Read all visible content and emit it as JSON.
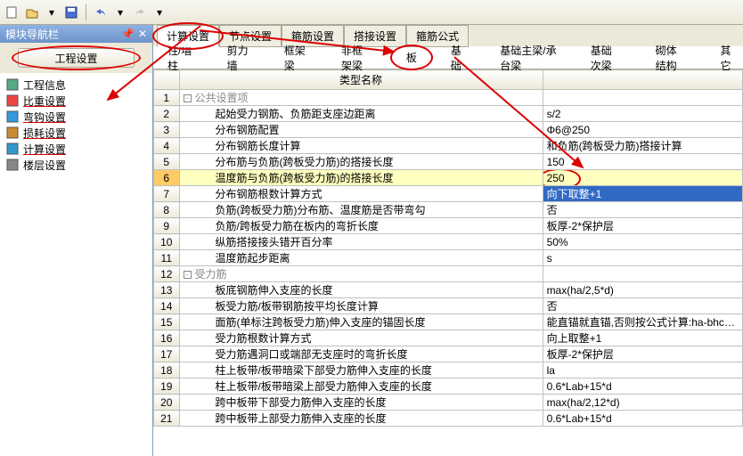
{
  "nav": {
    "title": "模块导航栏",
    "button": "工程设置",
    "items": [
      {
        "icon": "page-icon",
        "label": "工程信息"
      },
      {
        "icon": "weight-icon",
        "label": "比重设置"
      },
      {
        "icon": "hook-icon",
        "label": "弯钩设置"
      },
      {
        "icon": "loss-icon",
        "label": "损耗设置"
      },
      {
        "icon": "calc-icon",
        "label": "计算设置"
      },
      {
        "icon": "floor-icon",
        "label": "楼层设置"
      }
    ]
  },
  "tabs": [
    "计算设置",
    "节点设置",
    "箍筋设置",
    "搭接设置",
    "箍筋公式"
  ],
  "subtabs": [
    "柱/墙柱",
    "剪力墙",
    "框架梁",
    "非框架梁",
    "板",
    "基础",
    "基础主梁/承台梁",
    "基础次梁",
    "砌体结构",
    "其它"
  ],
  "grid": {
    "header_name": "类型名称",
    "header_val": "",
    "rows": [
      {
        "n": 1,
        "name": "公共设置项",
        "val": "",
        "section": true,
        "indent": 0
      },
      {
        "n": 2,
        "name": "起始受力钢筋、负筋距支座边距离",
        "val": "s/2",
        "indent": 1
      },
      {
        "n": 3,
        "name": "分布钢筋配置",
        "val": "Φ6@250",
        "indent": 1
      },
      {
        "n": 4,
        "name": "分布钢筋长度计算",
        "val": "和负筋(跨板受力筋)搭接计算",
        "indent": 1
      },
      {
        "n": 5,
        "name": "分布筋与负筋(跨板受力筋)的搭接长度",
        "val": "150",
        "indent": 1
      },
      {
        "n": 6,
        "name": "温度筋与负筋(跨板受力筋)的搭接长度",
        "val": "250",
        "indent": 1
      },
      {
        "n": 7,
        "name": "分布钢筋根数计算方式",
        "val": "向下取整+1",
        "indent": 1
      },
      {
        "n": 8,
        "name": "负筋(跨板受力筋)分布筋、温度筋是否带弯勾",
        "val": "否",
        "indent": 1
      },
      {
        "n": 9,
        "name": "负筋/跨板受力筋在板内的弯折长度",
        "val": "板厚-2*保护层",
        "indent": 1
      },
      {
        "n": 10,
        "name": "纵筋搭接接头错开百分率",
        "val": "50%",
        "indent": 1
      },
      {
        "n": 11,
        "name": "温度筋起步距离",
        "val": "s",
        "indent": 1
      },
      {
        "n": 12,
        "name": "受力筋",
        "val": "",
        "section": true,
        "indent": 0
      },
      {
        "n": 13,
        "name": "板底钢筋伸入支座的长度",
        "val": "max(ha/2,5*d)",
        "indent": 1
      },
      {
        "n": 14,
        "name": "板受力筋/板带钢筋按平均长度计算",
        "val": "否",
        "indent": 1
      },
      {
        "n": 15,
        "name": "面筋(单标注跨板受力筋)伸入支座的锚固长度",
        "val": "能直锚就直锚,否则按公式计算:ha-bhc+15*d",
        "indent": 1
      },
      {
        "n": 16,
        "name": "受力筋根数计算方式",
        "val": "向上取整+1",
        "indent": 1
      },
      {
        "n": 17,
        "name": "受力筋遇洞口或端部无支座时的弯折长度",
        "val": "板厚-2*保护层",
        "indent": 1
      },
      {
        "n": 18,
        "name": "柱上板带/板带暗梁下部受力筋伸入支座的长度",
        "val": "la",
        "indent": 1
      },
      {
        "n": 19,
        "name": "柱上板带/板带暗梁上部受力筋伸入支座的长度",
        "val": "0.6*Lab+15*d",
        "indent": 1
      },
      {
        "n": 20,
        "name": "跨中板带下部受力筋伸入支座的长度",
        "val": "max(ha/2,12*d)",
        "indent": 1
      },
      {
        "n": 21,
        "name": "跨中板带上部受力筋伸入支座的长度",
        "val": "0.6*Lab+15*d",
        "indent": 1
      }
    ]
  }
}
